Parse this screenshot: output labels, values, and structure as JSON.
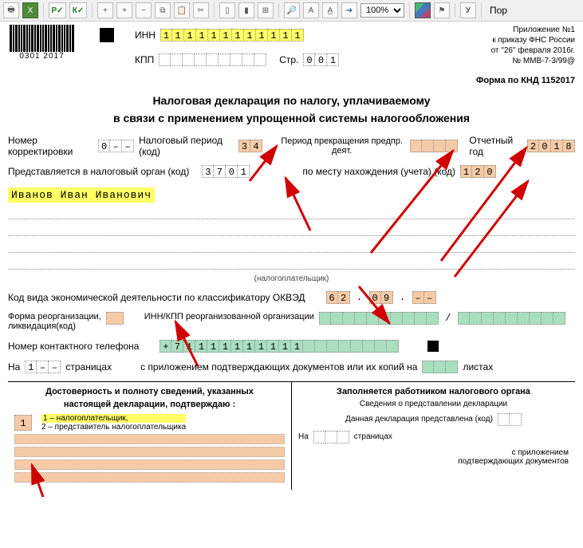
{
  "toolbar": {
    "zoom": "100%",
    "label_right": "Пор"
  },
  "barcode_text": "0301 2017",
  "inn_label": "ИНН",
  "inn": [
    "1",
    "1",
    "1",
    "1",
    "1",
    "1",
    "1",
    "1",
    "1",
    "1",
    "1",
    "1"
  ],
  "kpp_label": "КПП",
  "kpp": [
    "",
    "",
    "",
    "",
    "",
    "",
    "",
    "",
    ""
  ],
  "str_label": "Стр.",
  "str": [
    "0",
    "0",
    "1"
  ],
  "meta": {
    "l1": "Приложение №1",
    "l2": "к приказу ФНС России",
    "l3": "от \"26\" февраля 2016г.",
    "l4": "№ ММВ-7-3/99@"
  },
  "knd": "Форма по КНД 1152017",
  "title1": "Налоговая декларация по налогу, уплачиваемому",
  "title2": "в связи с применением упрощенной системы налогообложения",
  "korr_label": "Номер корректировки",
  "korr": [
    "0",
    "–",
    "–"
  ],
  "period_label": "Налоговый период (код)",
  "period": [
    "3",
    "4"
  ],
  "prekr_label": "Период прекращения предпр. деят.",
  "prekr": [
    "",
    "",
    "",
    ""
  ],
  "year_label": "Отчетный год",
  "year": [
    "2",
    "0",
    "1",
    "8"
  ],
  "organ_label": "Представляется в налоговый орган     (код)",
  "organ": [
    "3",
    "7",
    "0",
    "1"
  ],
  "mesto_label": "по месту нахождения (учета) (код)",
  "mesto": [
    "1",
    "2",
    "0"
  ],
  "fio": "Иванов Иван Иванович",
  "np_caption": "(налогоплательщик)",
  "okved_label": "Код вида экономической деятельности по классификатору ОКВЭД",
  "okved_p1": [
    "6",
    "2"
  ],
  "okved_p2": [
    "0",
    "9"
  ],
  "okved_p3": [
    "–",
    "–"
  ],
  "reorg_label1": "Форма реорганизации,",
  "reorg_label2": "ликвидация(код)",
  "reorg_code": [
    ""
  ],
  "reorg_inn_label": "ИНН/КПП реорганизованной организации",
  "reorg_inn": [
    "",
    "",
    "",
    "",
    "",
    "",
    "",
    "",
    "",
    ""
  ],
  "reorg_kpp": [
    "",
    "",
    "",
    "",
    "",
    "",
    "",
    "",
    ""
  ],
  "phone_label": "Номер контактного телефона",
  "phone": [
    "+",
    "7",
    "1",
    "1",
    "1",
    "1",
    "1",
    "1",
    "1",
    "1",
    "1",
    "1",
    "",
    "",
    "",
    "",
    "",
    "",
    "",
    ""
  ],
  "pages_label1": "На",
  "pages": [
    "1",
    "–",
    "–"
  ],
  "pages_label2": "страницах",
  "attach_label": "с приложением подтверждающих документов или их копий на",
  "attach": [
    "",
    "",
    ""
  ],
  "attach_label2": "листах",
  "left_h1": "Достоверность и полноту сведений, указанных",
  "left_h2": "настоящей декларации, подтверждаю :",
  "conf_code": "1",
  "conf_opt1": "1 – налогоплательщик,",
  "conf_opt2": "2 – представитель налогоплательщика",
  "right_h": "Заполняется работником налогового органа",
  "right_l1": "Сведения о представлении декларации",
  "right_l2": "Данная декларация представлена (код)",
  "right_on": "На",
  "right_pages_lbl": "страницах",
  "right_attach1": "с приложением",
  "right_attach2": "подтверждающих документов"
}
